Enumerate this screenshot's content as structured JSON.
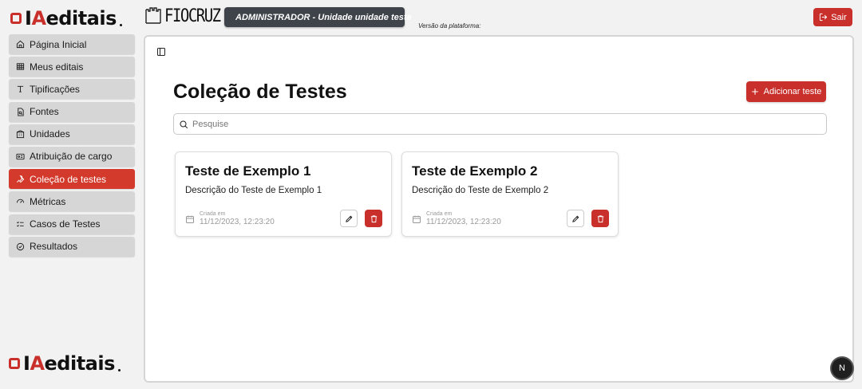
{
  "brand": {
    "logo_text": "IAeditais",
    "logo_accent": "A",
    "partner_name": "FIOCRUZ",
    "accent_color": "#c9302c"
  },
  "header": {
    "admin_label": "ADMINISTRADOR - Unidade unidade teste",
    "version_label": "Versão da plataforma:",
    "logout_label": "Sair"
  },
  "sidebar": {
    "items": [
      {
        "label": "Página Inicial",
        "icon": "home-icon",
        "active": false
      },
      {
        "label": "Meus editais",
        "icon": "table-icon",
        "active": false
      },
      {
        "label": "Tipificações",
        "icon": "type-icon",
        "active": false
      },
      {
        "label": "Fontes",
        "icon": "file-search-icon",
        "active": false
      },
      {
        "label": "Unidades",
        "icon": "building-icon",
        "active": false
      },
      {
        "label": "Atribuição de cargo",
        "icon": "id-card-icon",
        "active": false
      },
      {
        "label": "Coleção de testes",
        "icon": "wrench-icon",
        "active": true
      },
      {
        "label": "Métricas",
        "icon": "gauge-icon",
        "active": false
      },
      {
        "label": "Casos de Testes",
        "icon": "list-checks-icon",
        "active": false
      },
      {
        "label": "Resultados",
        "icon": "check-circle-icon",
        "active": false
      }
    ]
  },
  "main": {
    "title": "Coleção de Testes",
    "add_button_label": "Adicionar teste",
    "search_placeholder": "Pesquise",
    "cards": [
      {
        "title": "Teste de Exemplo 1",
        "description": "Descrição do Teste de Exemplo 1",
        "created_label": "Criada em",
        "created_at": "11/12/2023, 12:23:20"
      },
      {
        "title": "Teste de Exemplo 2",
        "description": "Descrição do Teste de Exemplo 2",
        "created_label": "Criada em",
        "created_at": "11/12/2023, 12:23:20"
      }
    ]
  },
  "dev_badge": "N"
}
